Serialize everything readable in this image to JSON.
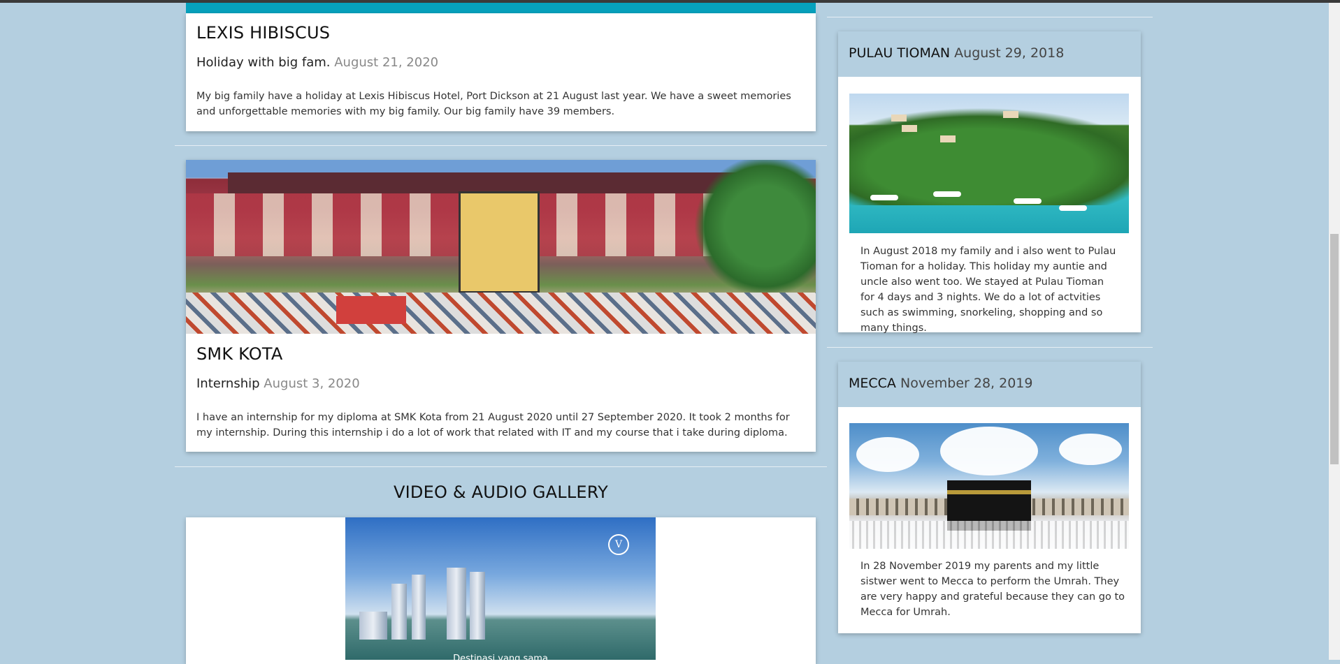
{
  "main": {
    "posts": [
      {
        "title": "LEXIS HIBISCUS",
        "subtitle": "Holiday with big fam.",
        "date": "August 21, 2020",
        "body": "My big family have a holiday at Lexis Hibiscus Hotel, Port Dickson at 21 August last year. We have a sweet memories and unforgettable memories with my big family. Our big family have 39 members."
      },
      {
        "title": "SMK KOTA",
        "subtitle": "Internship",
        "date": "August 3, 2020",
        "body": "I have an internship for my diploma at SMK Kota from 21 August 2020 until 27 September 2020. It took 2 months for my internship. During this internship i do a lot of work that related with IT and my course that i take during diploma."
      }
    ],
    "gallery_heading": "VIDEO & AUDIO GALLERY",
    "video_logo": "V",
    "video_caption": "Destinasi yang sama"
  },
  "sidebar": {
    "cards": [
      {
        "title": "PULAU TIOMAN",
        "date": "August 29, 2018",
        "body": "In August 2018 my family and i also went to Pulau Tioman for a holiday. This holiday my auntie and uncle also went too. We stayed at Pulau Tioman for 4 days and 3 nights. We do a lot of actvities such as swimming, snorkeling, shopping and so many things."
      },
      {
        "title": "MECCA",
        "date": "November 28, 2019",
        "body": "In 28 November 2019 my parents and my little sistwer went to Mecca to perform the Umrah. They are very happy and grateful because they can go to Mecca for Umrah."
      }
    ]
  },
  "colors": {
    "page_bg": "#b4cfe0",
    "accent_teal": "#06a1bd",
    "card_bg": "#ffffff",
    "date_gray": "#888888"
  }
}
